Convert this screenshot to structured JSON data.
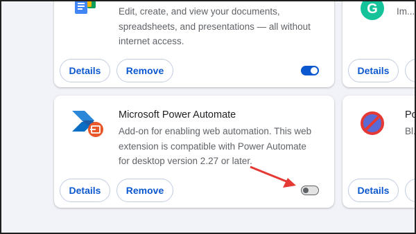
{
  "extensions": [
    {
      "title": "",
      "description": "Edit, create, and view your documents, spreadsheets, and presentations — all without internet access.",
      "details_label": "Details",
      "remove_label": "Remove",
      "enabled": true,
      "icon": "google-docs-offline-icon"
    },
    {
      "title": "",
      "description": "Im...",
      "details_label": "Details",
      "remove_label": "",
      "enabled": true,
      "icon": "grammarly-icon"
    },
    {
      "title": "Microsoft Power Automate",
      "description": "Add-on for enabling web automation. This web extension is compatible with Power Automate for desktop version 2.27 or later.",
      "details_label": "Details",
      "remove_label": "Remove",
      "enabled": false,
      "icon": "power-automate-icon"
    },
    {
      "title": "Po",
      "description": "Bl...",
      "details_label": "Details",
      "remove_label": "",
      "enabled": true,
      "icon": "block-icon"
    }
  ],
  "colors": {
    "accent": "#0b57d0",
    "annotation_arrow": "#e53935"
  }
}
